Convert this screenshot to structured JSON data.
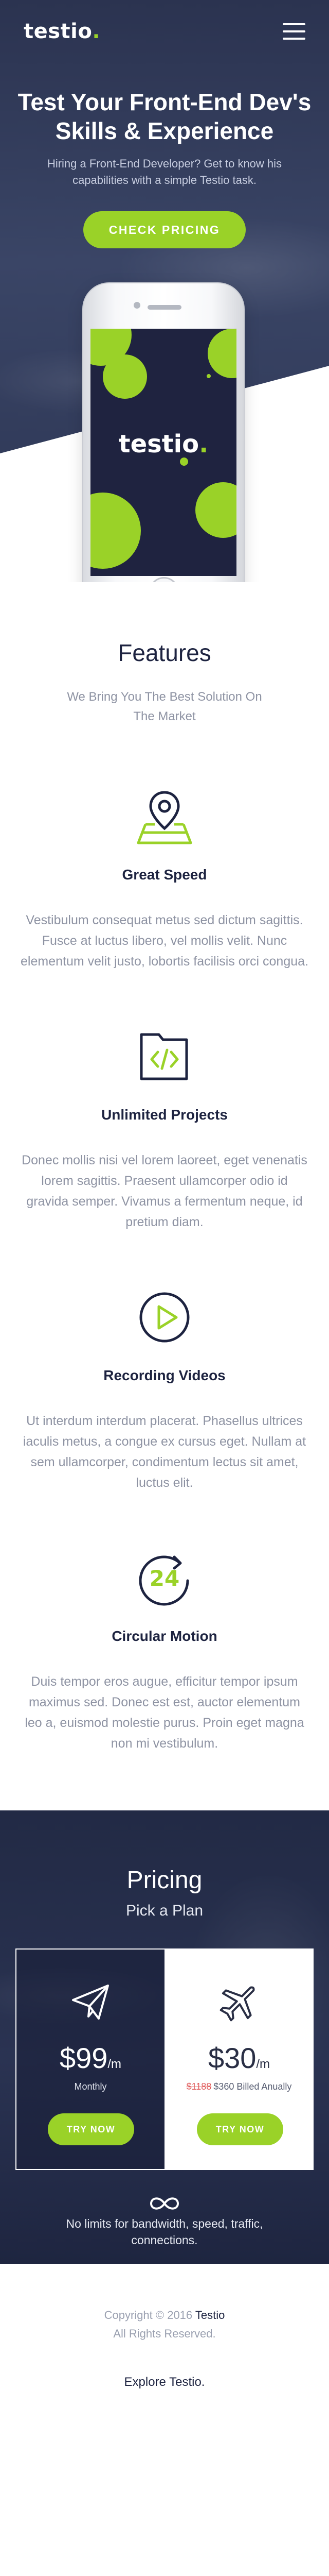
{
  "header": {
    "logo": "testio",
    "logo_dot": "."
  },
  "hero": {
    "title": "Test Your Front-End Dev's Skills & Experience",
    "subtitle": "Hiring a Front-End Developer? Get to know his capabilities with a simple Testio task.",
    "cta_label": "CHECK PRICING",
    "phone_logo": "testio",
    "phone_logo_dot": "."
  },
  "features": {
    "title": "Features",
    "lead": "We Bring You The Best Solution On The Market",
    "items": [
      {
        "icon": "map-pin-icon",
        "title": "Great Speed",
        "text": "Vestibulum consequat metus sed dictum sagittis. Fusce at luctus libero, vel mollis velit. Nunc elementum velit justo, lobortis facilisis orci congua."
      },
      {
        "icon": "code-folder-icon",
        "title": "Unlimited Projects",
        "text": "Donec mollis nisi vel lorem laoreet, eget venenatis lorem sagittis. Praesent ullamcorper odio id gravida semper. Vivamus a fermentum neque, id pretium diam."
      },
      {
        "icon": "play-icon",
        "title": "Recording Videos",
        "text": "Ut interdum interdum placerat. Phasellus ultrices iaculis metus, a congue ex cursus eget. Nullam at sem ullamcorper, condimentum lectus sit amet, luctus elit."
      },
      {
        "icon": "24-hours-icon",
        "title": "Circular Motion",
        "icon_text": "24",
        "text": "Duis tempor eros augue, efficitur tempor ipsum maximus sed. Donec est est, auctor elementum leo a, euismod molestie purus. Proin eget magna non mi vestibulum."
      }
    ]
  },
  "pricing": {
    "title": "Pricing",
    "subtitle": "Pick a Plan",
    "plans": [
      {
        "icon": "paper-plane-icon",
        "price": "$99",
        "period": "/m",
        "note": "Monthly",
        "old_price": "",
        "button": "TRY NOW"
      },
      {
        "icon": "airplane-icon",
        "price": "$30",
        "period": "/m",
        "note": "$360 Billed Anually",
        "old_price": "$1188",
        "button": "TRY NOW"
      }
    ],
    "limits": "No limits for bandwidth, speed, traffic, connections."
  },
  "footer": {
    "copyright": "Copyright © 2016",
    "brand": "Testio",
    "rights": "All Rights Reserved.",
    "explore": "Explore Testio."
  },
  "colors": {
    "accent": "#9ad228",
    "navy": "#1d2340",
    "muted": "#8e93a3",
    "old_price": "#e05b5b"
  }
}
